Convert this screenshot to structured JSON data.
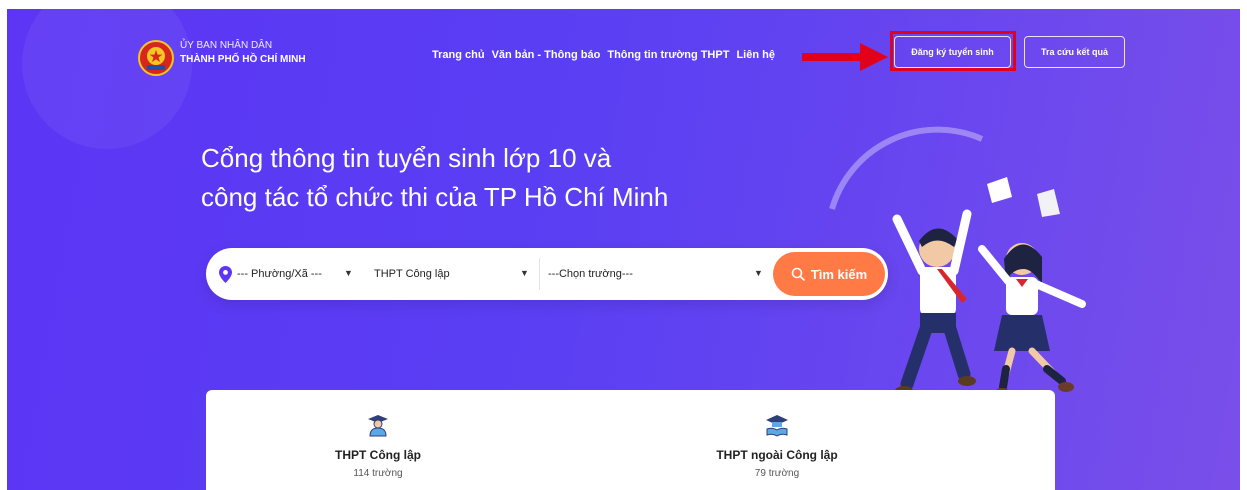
{
  "header": {
    "org_line1": "ỦY BAN NHÂN DÂN",
    "org_line2": "THÀNH PHỐ HỒ CHÍ MINH",
    "nav": [
      "Trang chủ",
      "Văn bản - Thông báo",
      "Thông tin trường THPT",
      "Liên hệ"
    ],
    "register_label": "Đăng ký tuyển sinh",
    "lookup_label": "Tra cứu kết quả"
  },
  "hero": {
    "title_line1": "Cổng thông tin tuyển sinh lớp 10 và",
    "title_line2": "công tác tổ chức thi của TP Hồ Chí Minh"
  },
  "search": {
    "ward_value": "--- Phường/Xã ---",
    "type_value": "THPT Công lập",
    "school_value": "---Chọn trường---",
    "button_label": "Tìm kiếm"
  },
  "stats": [
    {
      "label": "THPT Công lập",
      "count": "114 trường",
      "icon": "graduate-student-icon"
    },
    {
      "label": "THPT ngoài Công lập",
      "count": "79 trường",
      "icon": "graduation-cap-book-icon"
    }
  ],
  "colors": {
    "accent_orange": "#ff7a45",
    "background_purple": "#5c35f5",
    "highlight_red": "#e3001b"
  }
}
